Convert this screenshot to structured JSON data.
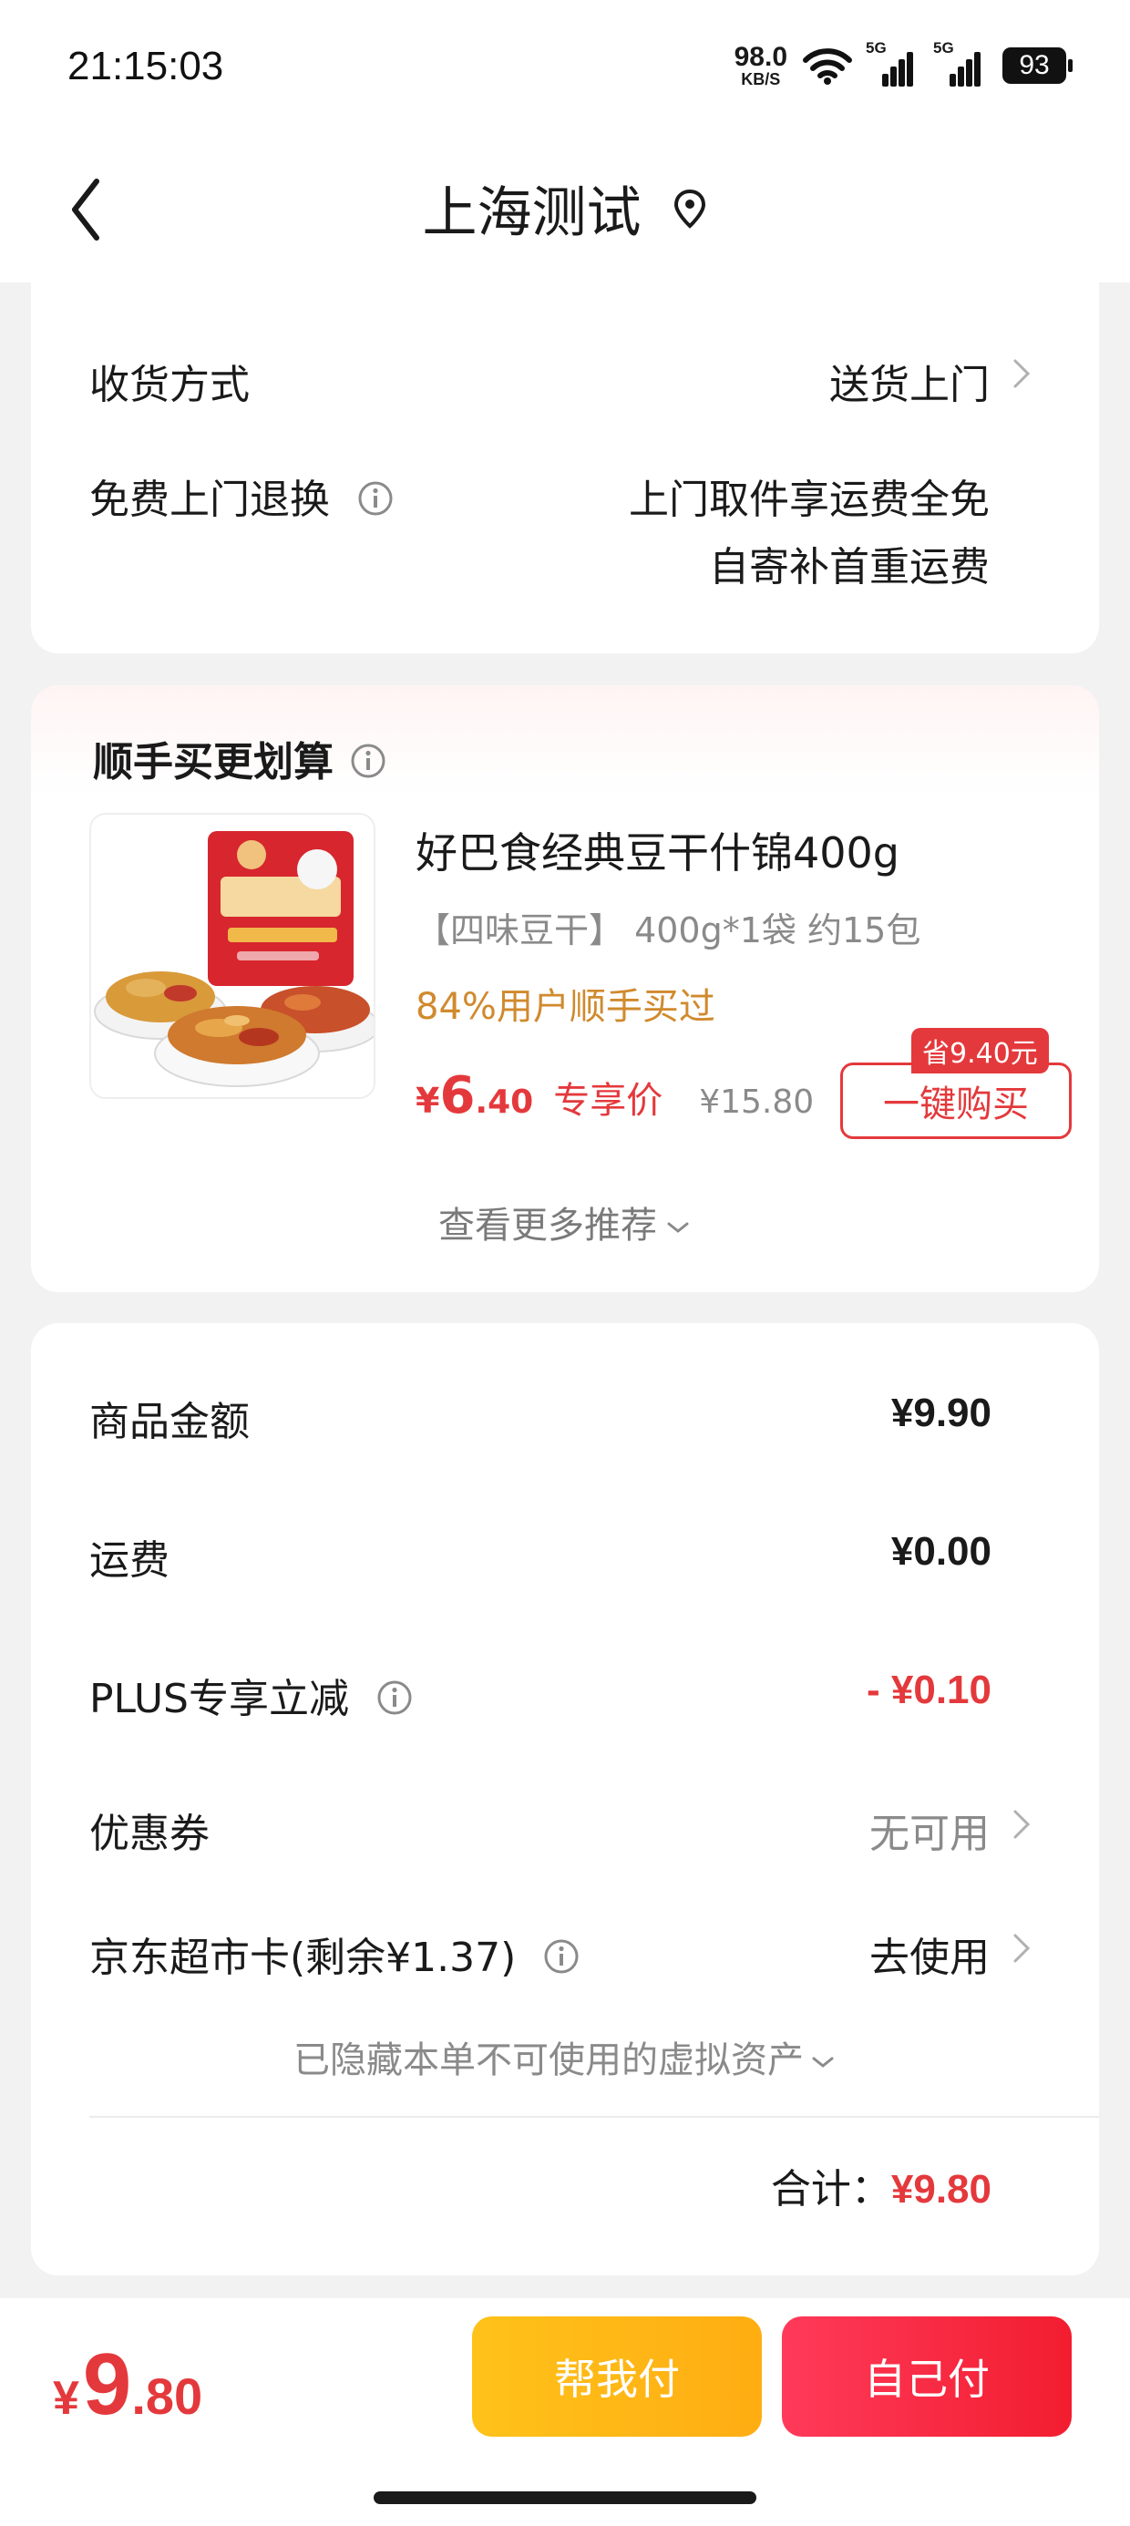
{
  "status": {
    "time": "21:15:03",
    "net_speed": "98.0",
    "net_unit": "KB/S",
    "sig1": "5G",
    "sig2": "5G",
    "battery": "93"
  },
  "nav": {
    "title": "上海测试"
  },
  "delivery": {
    "method_label": "收货方式",
    "method_value": "送货上门",
    "return_label": "免费上门退换",
    "return_line1": "上门取件享运费全免",
    "return_line2": "自寄补首重运费"
  },
  "reco": {
    "title": "顺手买更划算",
    "product": {
      "name": "好巴食经典豆干什锦400g",
      "spec": "【四味豆干】 400g*1袋 约15包",
      "bought": "84%用户顺手买过",
      "price_currency": "¥",
      "price_int": "6",
      "price_dec": ".40",
      "exclusive_label": "专享价",
      "original_price": "¥15.80",
      "save_badge": "省9.40元",
      "buy_label": "一键购买"
    },
    "more_label": "查看更多推荐"
  },
  "summary": {
    "goods_label": "商品金额",
    "goods_value": "¥9.90",
    "shipping_label": "运费",
    "shipping_value": "¥0.00",
    "plus_label": "PLUS专享立减",
    "plus_value": "- ¥0.10",
    "coupon_label": "优惠券",
    "coupon_value": "无可用",
    "card_label": "京东超市卡(剩余¥1.37)",
    "card_value": "去使用",
    "hidden_assets": "已隐藏本单不可使用的虚拟资产",
    "total_label": "合计：",
    "total_value": "¥9.80"
  },
  "bottom": {
    "price_currency": "¥",
    "price_int": "9",
    "price_dec": ".80",
    "help_pay": "帮我付",
    "self_pay": "自己付"
  },
  "colors": {
    "accent_red": "#e4393c",
    "gold": "#d08a2d",
    "help_btn": "#ffb816",
    "self_btn": "#f72a42"
  }
}
